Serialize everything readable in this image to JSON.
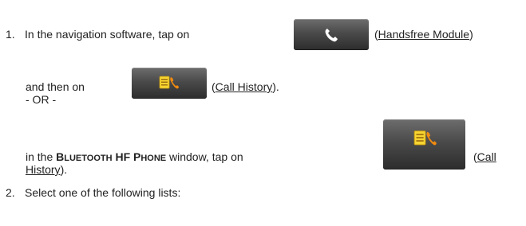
{
  "steps": [
    {
      "number": "1.",
      "line1_prefix": "In the navigation software, tap on",
      "button1_icon": "phone-handset-icon",
      "button1_label": "Handsfree Module",
      "line2_prefix": "and then on",
      "button2_icon": "call-history-icon",
      "button2_label": "Call History",
      "alternative": "- OR -",
      "line3_prefix": "in the",
      "window_name_1": "B",
      "window_name_2": "LUETOOTH",
      "window_name_3": "HF P",
      "window_name_4": "HONE",
      "line3_mid": "window, tap on",
      "button3_icon": "call-history-icon",
      "button3_label_part1": "Call",
      "button3_label_part2": "History"
    },
    {
      "number": "2.",
      "text": "Select one of the following lists:"
    }
  ],
  "colors": {
    "text": "#222222",
    "button_dark": "#2c2c2c",
    "icon_orange": "#f08a10",
    "icon_yellow": "#f6d531"
  }
}
